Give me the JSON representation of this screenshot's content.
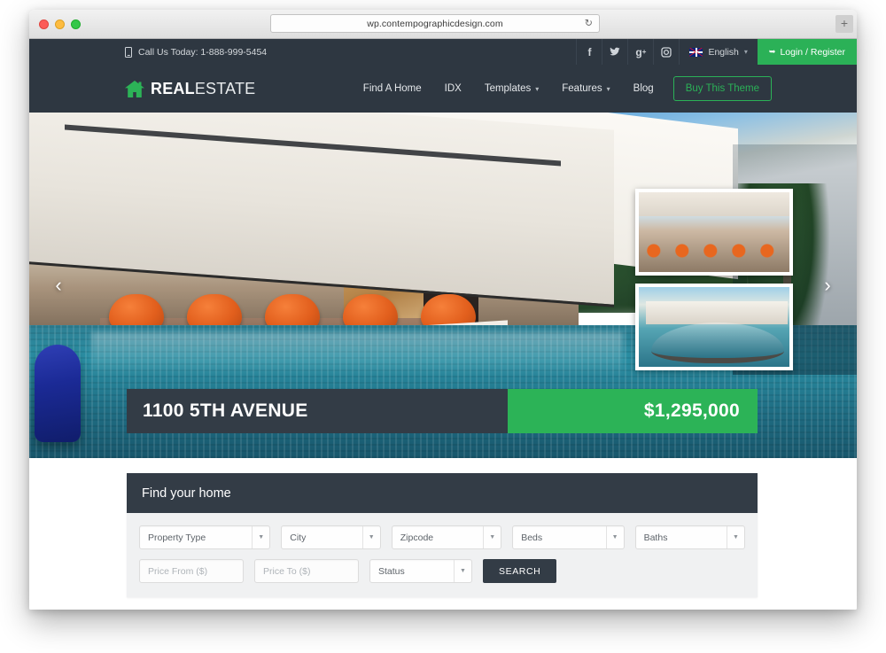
{
  "browser": {
    "url": "wp.contempographicdesign.com",
    "reload_icon": "reload-icon",
    "new_tab_label": "+",
    "traffic_lights": [
      "close",
      "minimize",
      "zoom"
    ]
  },
  "topbar": {
    "phone_icon": "mobile-phone-icon",
    "phone_text": "Call Us Today: 1-888-999-5454",
    "social": [
      {
        "name": "facebook-icon",
        "glyph": "f"
      },
      {
        "name": "twitter-icon",
        "glyph": "✈"
      },
      {
        "name": "google-plus-icon",
        "glyph": "g+"
      },
      {
        "name": "instagram-icon",
        "glyph": "▣"
      }
    ],
    "language": {
      "label": "English",
      "flag": "uk-flag-icon",
      "caret": "▾"
    },
    "login": {
      "label": "Login / Register",
      "icon": "↵",
      "color": "#2bb157"
    }
  },
  "header": {
    "logo": {
      "bold": "REAL",
      "light": "ESTATE",
      "icon": "house-icon",
      "color": "#2cb357"
    },
    "menu": [
      {
        "label": "Find A Home",
        "has_caret": false
      },
      {
        "label": "IDX",
        "has_caret": false
      },
      {
        "label": "Templates",
        "has_caret": true
      },
      {
        "label": "Features",
        "has_caret": true
      },
      {
        "label": "Blog",
        "has_caret": false
      }
    ],
    "cta": {
      "label": "Buy This Theme",
      "color": "#2bb157"
    }
  },
  "hero": {
    "prev_arrow": "‹",
    "next_arrow": "›",
    "thumbnails": [
      {
        "name": "thumbnail-living-room"
      },
      {
        "name": "thumbnail-pool-exterior"
      }
    ],
    "listing": {
      "address": "1100 5TH AVENUE",
      "price": "$1,295,000",
      "address_bg": "#333c46",
      "price_bg": "#2cb357"
    }
  },
  "search_panel": {
    "title": "Find your home",
    "row1": [
      {
        "name": "property-type",
        "label": "Property Type"
      },
      {
        "name": "city",
        "label": "City"
      },
      {
        "name": "zipcode",
        "label": "Zipcode"
      },
      {
        "name": "beds",
        "label": "Beds"
      },
      {
        "name": "baths",
        "label": "Baths"
      }
    ],
    "row2": {
      "price_from_placeholder": "Price From ($)",
      "price_from_value": "",
      "price_to_placeholder": "Price To ($)",
      "price_to_value": "",
      "status_label": "Status",
      "search_label": "SEARCH"
    }
  }
}
